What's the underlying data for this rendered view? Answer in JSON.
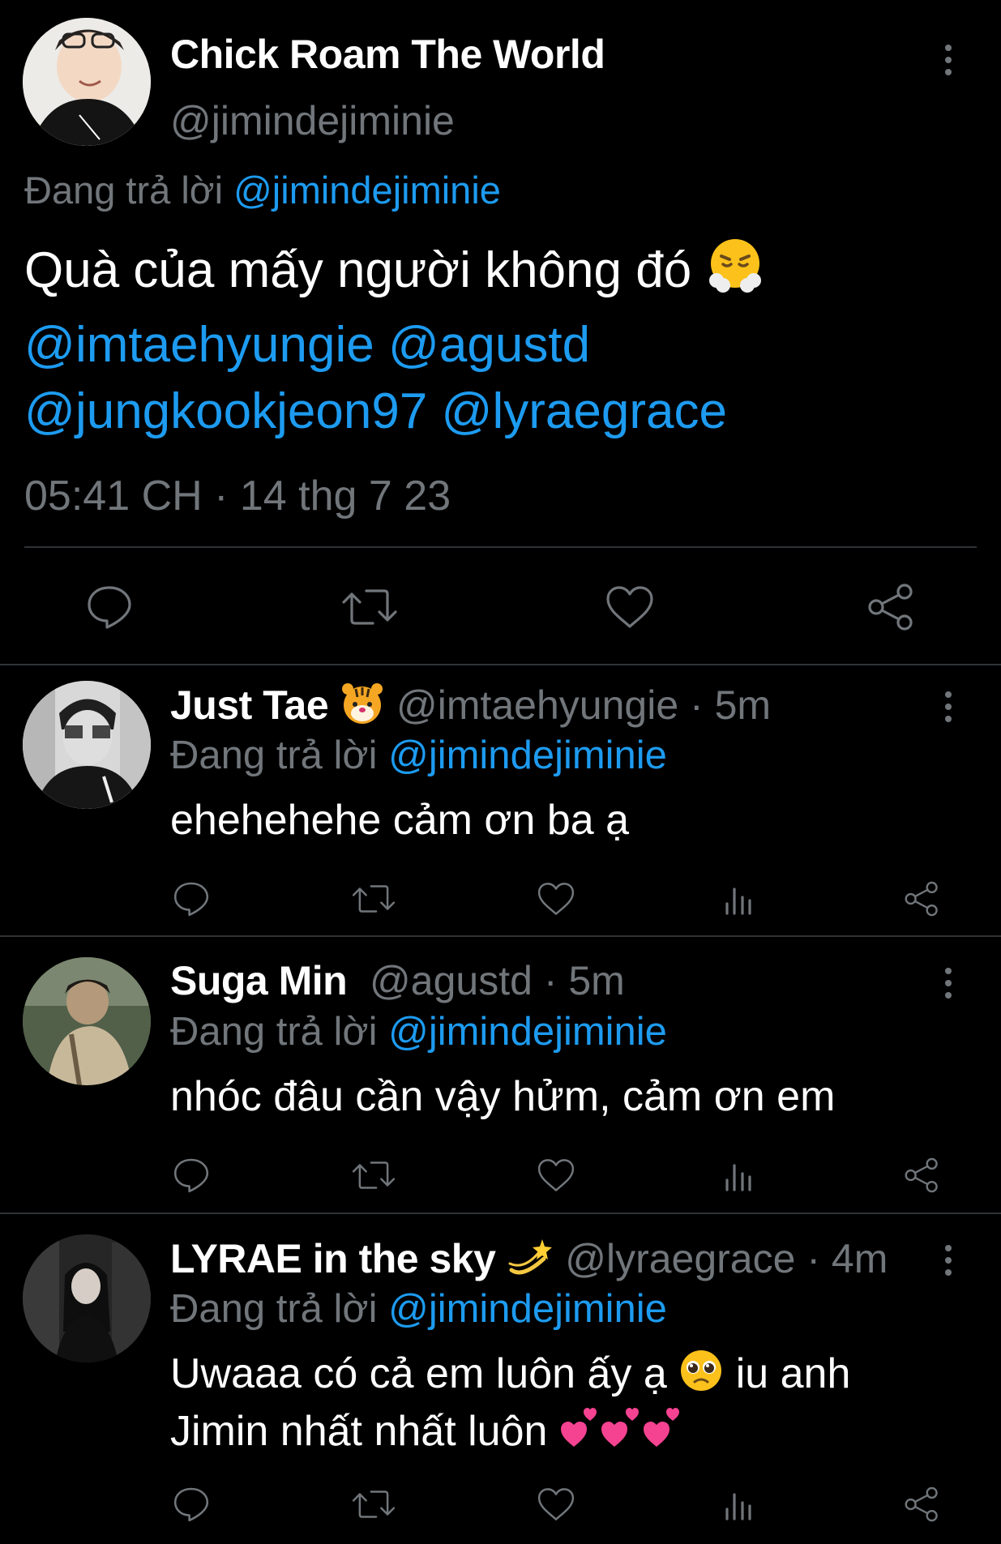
{
  "main_tweet": {
    "display_name": "Chick Roam The World",
    "handle": "@jimindejiminie",
    "replying_prefix": "Đang trả lời",
    "replying_to": "@jimindejiminie",
    "text": "Quà của mấy người không đó",
    "emoji": "huffing-face",
    "mentions": [
      "@imtaehyungie",
      "@agustd",
      "@jungkookjeon97",
      "@lyraegrace"
    ],
    "timestamp": "05:41 CH · 14 thg 7 23",
    "actions": [
      "reply-icon",
      "retweet-icon",
      "like-icon",
      "share-icon"
    ]
  },
  "replies": [
    {
      "display_name": "Just Tae",
      "name_emoji": "tiger-face",
      "handle": "@imtaehyungie",
      "time": "· 5m",
      "replying_prefix": "Đang trả lời",
      "replying_to": "@jimindejiminie",
      "text": "ehehehehe cảm ơn ba ạ"
    },
    {
      "display_name": "Suga Min",
      "handle": "@agustd",
      "time": "· 5m",
      "replying_prefix": "Đang trả lời",
      "replying_to": "@jimindejiminie",
      "text": "nhóc đâu cần vậy hửm, cảm ơn em"
    },
    {
      "display_name": "LYRAE in the sky",
      "name_emoji": "dizzy",
      "handle": "@lyraegrace",
      "time": "· 4m",
      "replying_prefix": "Đang trả lời",
      "replying_to": "@jimindejiminie",
      "text_part1": "Uwaaa có cả em luôn ấy ạ",
      "text_part2": "iu anh Jimin nhất nhất luôn",
      "text_emojis": [
        "pleading-face",
        "two-hearts"
      ]
    }
  ],
  "colors": {
    "background": "#000000",
    "text": "#e7e9ea",
    "muted": "#71767b",
    "link": "#1d9bf0",
    "divider": "#2f3336"
  }
}
